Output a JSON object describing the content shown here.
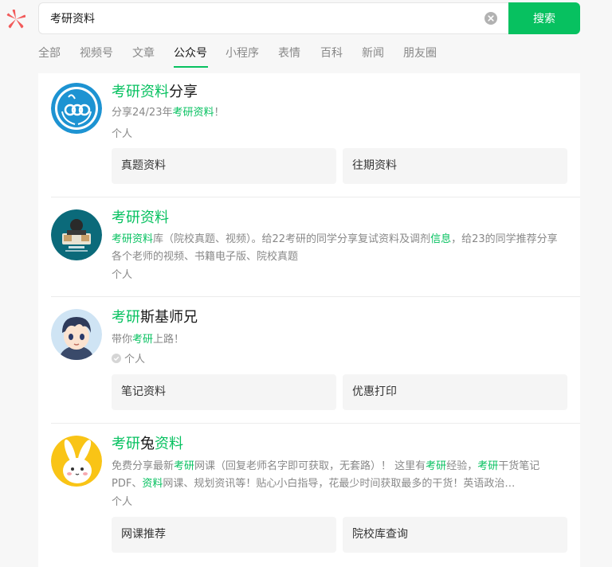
{
  "search": {
    "value": "考研资料",
    "button_label": "搜索"
  },
  "tabs": [
    {
      "label": "全部"
    },
    {
      "label": "视频号"
    },
    {
      "label": "文章"
    },
    {
      "label": "公众号"
    },
    {
      "label": "小程序"
    },
    {
      "label": "表情"
    },
    {
      "label": "百科"
    },
    {
      "label": "新闻"
    },
    {
      "label": "朋友圈"
    }
  ],
  "active_tab": "公众号",
  "results": [
    {
      "title_hl": "考研资料",
      "title_rest": "分享",
      "desc_pre": "分享24/23年",
      "desc_hl": "考研资料",
      "desc_post": "！",
      "type": "个人",
      "menus": [
        "真题资料",
        "往期资料"
      ]
    },
    {
      "title_hl": "考研资料",
      "title_rest": "",
      "desc_hl1": "考研资料",
      "desc_mid": "库（院校真题、视频）。给22考研的同学分享复试资料及调剂",
      "desc_hl2": "信息",
      "desc_post": "，给23的同学推荐分享各个老师的视频、书籍电子版、院校真题",
      "type": "个人"
    },
    {
      "title_hl": "考研",
      "title_rest": "斯基师兄",
      "desc_pre": "带你",
      "desc_hl": "考研",
      "desc_post": "上路！",
      "type": "个人",
      "menus": [
        "笔记资料",
        "优惠打印"
      ]
    },
    {
      "title_hl": "考研",
      "title_mid": "兔",
      "title_hl2": "资料",
      "desc_a": "免费分享最新",
      "desc_hl1": "考研",
      "desc_b": "网课（回复老师名字即可获取，无套路）！ 这里有",
      "desc_hl2": "考研",
      "desc_c": "经验，",
      "desc_hl3": "考研",
      "desc_d": "干货笔记PDF、",
      "desc_hl4": "资料",
      "desc_e": "网课、规划资讯等！贴心小白指导，花最少时间获取最多的干货！英语政治…",
      "type": "个人",
      "menus": [
        "网课推荐",
        "院校库查询"
      ]
    }
  ],
  "colors": {
    "accent": "#07c160",
    "muted": "#888888",
    "logo": "#fa5151"
  }
}
